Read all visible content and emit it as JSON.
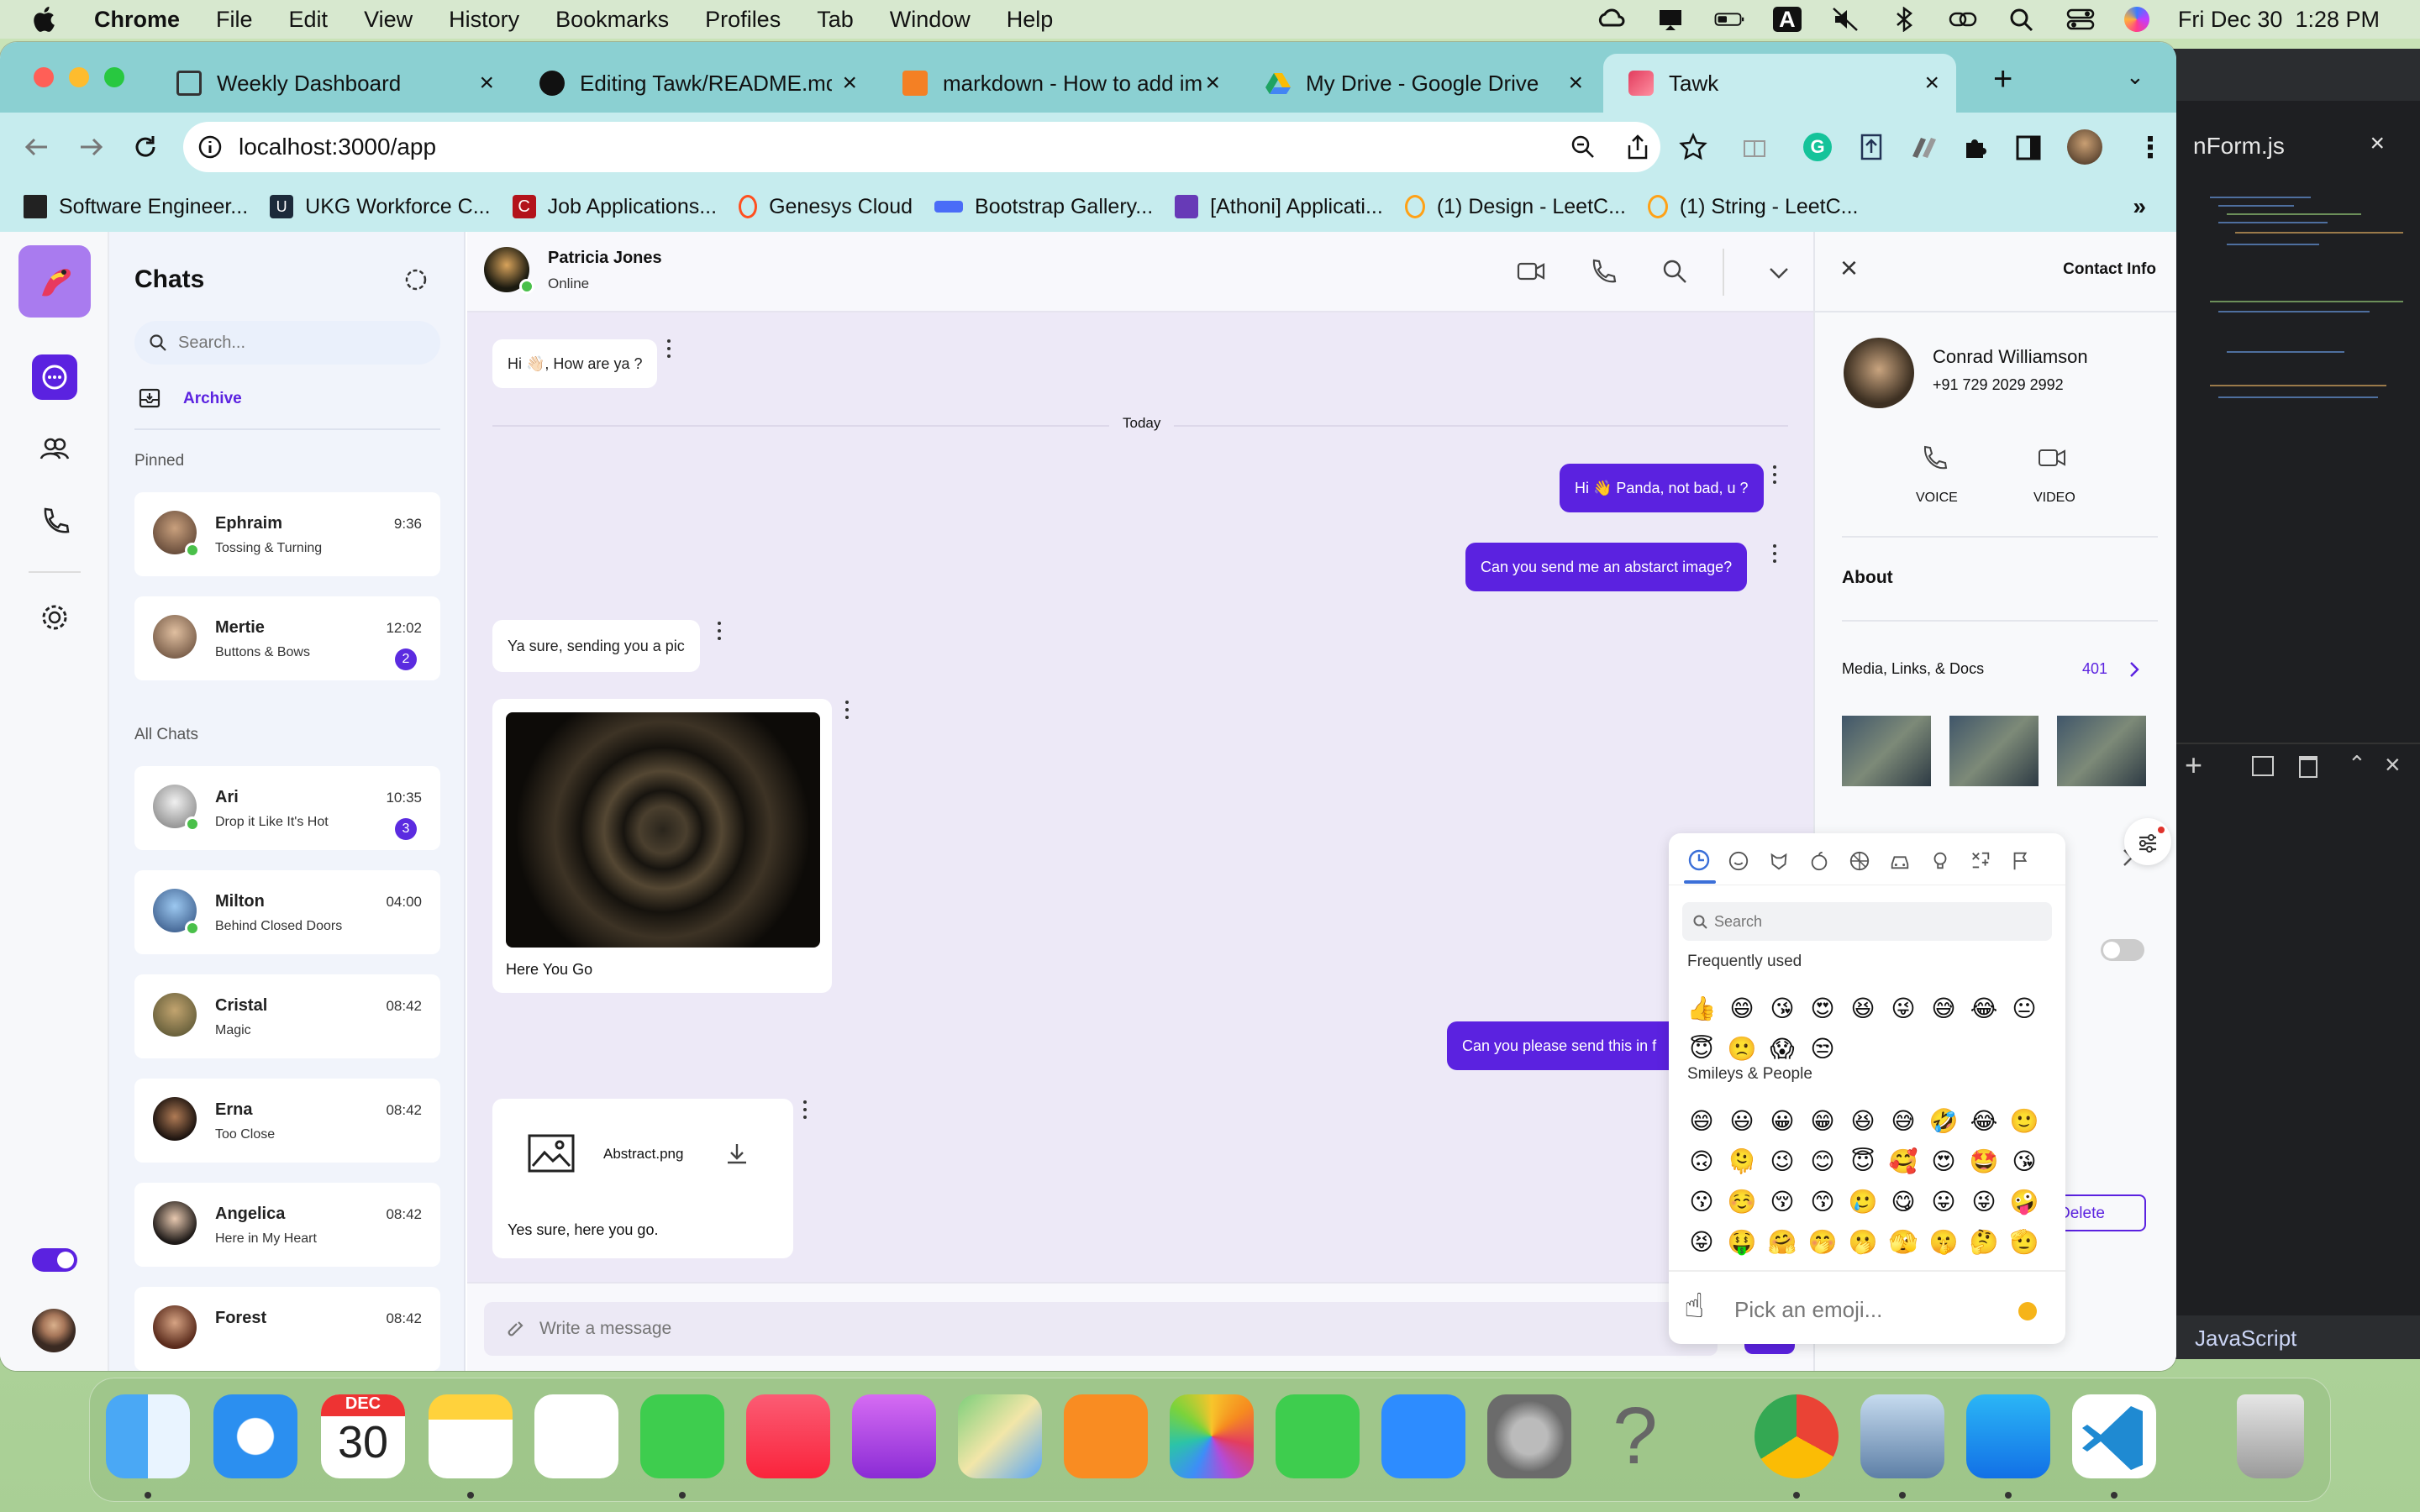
{
  "menubar": {
    "app": "Chrome",
    "items": [
      "File",
      "Edit",
      "View",
      "History",
      "Bookmarks",
      "Profiles",
      "Tab",
      "Window",
      "Help"
    ],
    "clock": "Fri Dec 30  1:28 PM",
    "input_indicator": "A"
  },
  "browser": {
    "tabs": [
      {
        "title": "Weekly Dashboard"
      },
      {
        "title": "Editing Tawk/README.md at"
      },
      {
        "title": "markdown - How to add ima"
      },
      {
        "title": "My Drive - Google Drive"
      },
      {
        "title": "Tawk"
      }
    ],
    "address": "localhost:3000/app",
    "bookmarks": [
      "Software Engineer...",
      "UKG Workforce C...",
      "Job Applications...",
      "Genesys Cloud",
      "Bootstrap Gallery...",
      "[Athoni] Applicati...",
      "(1) Design - LeetC...",
      "(1) String - LeetC..."
    ]
  },
  "vscode": {
    "tab": "nForm.js",
    "status_lang": "JavaScript"
  },
  "sidebar": {
    "title": "Chats",
    "search_placeholder": "Search...",
    "archive": "Archive",
    "pinned_label": "Pinned",
    "all_label": "All Chats",
    "pinned": [
      {
        "name": "Ephraim",
        "msg": "Tossing & Turning",
        "time": "9:36",
        "online": true,
        "badge": ""
      },
      {
        "name": "Mertie",
        "msg": "Buttons & Bows",
        "time": "12:02",
        "online": false,
        "badge": "2"
      }
    ],
    "chats": [
      {
        "name": "Ari",
        "msg": "Drop it Like It's Hot",
        "time": "10:35",
        "online": true,
        "badge": "3"
      },
      {
        "name": "Milton",
        "msg": "Behind Closed Doors",
        "time": "04:00",
        "online": true,
        "badge": ""
      },
      {
        "name": "Cristal",
        "msg": "Magic",
        "time": "08:42",
        "online": false,
        "badge": ""
      },
      {
        "name": "Erna",
        "msg": "Too Close",
        "time": "08:42",
        "online": false,
        "badge": ""
      },
      {
        "name": "Angelica",
        "msg": "Here in My Heart",
        "time": "08:42",
        "online": false,
        "badge": ""
      },
      {
        "name": "Forest",
        "msg": "",
        "time": "08:42",
        "online": false,
        "badge": ""
      }
    ]
  },
  "conversation": {
    "name": "Patricia Jones",
    "status": "Online",
    "divider": "Today",
    "messages": {
      "m1": "Hi 👋🏻, How are ya ?",
      "m2": "Hi 👋 Panda, not bad, u ?",
      "m3": "Can you send me an abstarct image?",
      "m4": "Ya sure, sending you a pic",
      "m5_caption": "Here You Go",
      "m6": "Can you please send this in f",
      "m7_file": "Abstract.png",
      "m7_caption": "Yes sure, here you go."
    },
    "input_placeholder": "Write a message"
  },
  "contact": {
    "header": "Contact Info",
    "name": "Conrad Williamson",
    "phone": "+91 729 2029 2992",
    "voice": "VOICE",
    "video": "VIDEO",
    "about": "About",
    "media_label": "Media, Links, & Docs",
    "media_count": "401",
    "delete": "Delete"
  },
  "emoji_picker": {
    "search_placeholder": "Search",
    "section_frequent": "Frequently used",
    "section_smileys": "Smileys & People",
    "preview_placeholder": "Pick an emoji...",
    "frequent_row1": [
      "👍",
      "😄",
      "😘",
      "😍",
      "😆",
      "😜",
      "😅",
      "😂",
      "😐"
    ],
    "frequent_row2": [
      "😇",
      "🙁",
      "😱",
      "😒"
    ],
    "smileys_row1": [
      "😄",
      "😃",
      "😀",
      "😁",
      "😆",
      "😅",
      "🤣",
      "😂",
      "🙂"
    ],
    "smileys_row2": [
      "🙃",
      "🫠",
      "😉",
      "😊",
      "😇",
      "🥰",
      "😍",
      "🤩",
      "😘"
    ],
    "smileys_row3": [
      "😗",
      "☺️",
      "😚",
      "😙",
      "🥲",
      "😋",
      "😛",
      "😜",
      "🤪"
    ],
    "smileys_row4": [
      "😝",
      "🤑",
      "🤗",
      "🤭",
      "🫢",
      "🫣",
      "🤫",
      "🤔",
      "🫡"
    ]
  },
  "dock": {
    "calendar_month": "DEC",
    "calendar_day": "30"
  },
  "colors": {
    "accent": "#5b22e0",
    "tabstrip": "#8bd0d2",
    "toolbar": "#c6ecee",
    "online": "#4ac04a"
  }
}
